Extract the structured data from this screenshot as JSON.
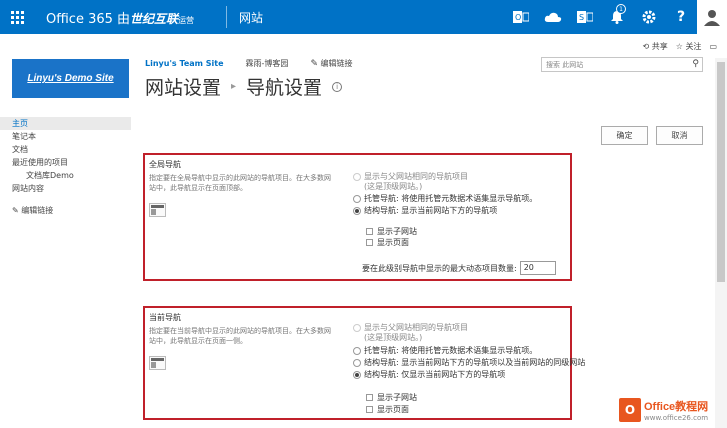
{
  "suitebar": {
    "brand_main": "Office 365 ",
    "brand_by": "由",
    "brand_partner": "世纪互联",
    "brand_op": "运营",
    "app_name": "网站",
    "colors": {
      "bar": "#0072c6"
    }
  },
  "share": {
    "share_label": "共享",
    "follow_label": "关注"
  },
  "site": {
    "logo_text": "Linyu's Demo Site"
  },
  "topnav": {
    "site_title": "Linyu's Team Site",
    "item_1": "霖雨-博客园",
    "edit_link": "编辑链接"
  },
  "page": {
    "title_part1": "网站设置",
    "title_part2": "导航设置"
  },
  "search": {
    "placeholder": "搜索 此网站"
  },
  "leftnav": {
    "items": [
      "主页",
      "笔记本",
      "文档",
      "最近使用的项目",
      "文档库Demo",
      "网站内容"
    ],
    "edit_link": "编辑链接"
  },
  "buttons": {
    "ok": "确定",
    "cancel": "取消"
  },
  "global_nav": {
    "title": "全局导航",
    "description": "指定要在全局导航中显示的此网站的导航项目。在大多数网站中，此导航显示在页面顶部。",
    "opt_inherit": "显示与父网站相同的导航项目",
    "opt_inherit_note": "(这是顶级网站。)",
    "opt_managed": "托管导航: 将使用托管元数据术语集显示导航项。",
    "opt_structural": "结构导航: 显示当前网站下方的导航项",
    "chk_subsites": "显示子网站",
    "chk_pages": "显示页面",
    "max_label": "要在此级别导航中显示的最大动态项目数量:",
    "max_value": "20"
  },
  "current_nav": {
    "title": "当前导航",
    "description": "指定要在当前导航中显示的此网站的导航项目。在大多数网站中，此导航显示在页面一侧。",
    "opt_inherit": "显示与父网站相同的导航项目",
    "opt_inherit_note": "(这是顶级网站。)",
    "opt_managed": "托管导航: 将使用托管元数据术语集显示导航项。",
    "opt_structural_siblings": "结构导航: 显示当前网站下方的导航项以及当前网站的同级网站",
    "opt_structural_below": "结构导航: 仅显示当前网站下方的导航项",
    "chk_subsites": "显示子网站",
    "chk_pages": "显示页面"
  },
  "watermark": {
    "line1": "Office教程网",
    "line2": "www.office26.com"
  }
}
